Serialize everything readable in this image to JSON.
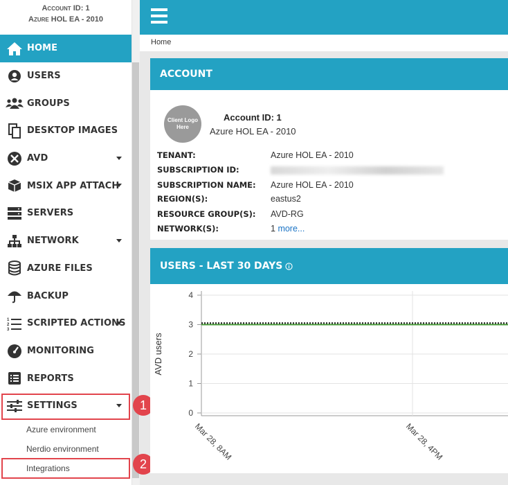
{
  "sidebar": {
    "account_id": "Account ID: 1",
    "account_name": "Azure HOL EA - 2010",
    "items": [
      {
        "label": "HOME",
        "icon": "home-icon",
        "active": true,
        "caret": false
      },
      {
        "label": "USERS",
        "icon": "user-icon",
        "caret": false
      },
      {
        "label": "GROUPS",
        "icon": "group-icon",
        "caret": false
      },
      {
        "label": "DESKTOP IMAGES",
        "icon": "copy-icon",
        "caret": false
      },
      {
        "label": "AVD",
        "icon": "avd-icon",
        "caret": true
      },
      {
        "label": "MSIX APP ATTACH",
        "icon": "box-icon",
        "caret": true
      },
      {
        "label": "SERVERS",
        "icon": "server-icon",
        "caret": false
      },
      {
        "label": "NETWORK",
        "icon": "network-icon",
        "caret": true
      },
      {
        "label": "AZURE FILES",
        "icon": "database-icon",
        "caret": false
      },
      {
        "label": "BACKUP",
        "icon": "umbrella-icon",
        "caret": false
      },
      {
        "label": "SCRIPTED ACTIONS",
        "icon": "list-numbered-icon",
        "caret": true
      },
      {
        "label": "MONITORING",
        "icon": "gauge-icon",
        "caret": false
      },
      {
        "label": "REPORTS",
        "icon": "list-icon",
        "caret": false
      },
      {
        "label": "SETTINGS",
        "icon": "sliders-icon",
        "caret": true
      }
    ],
    "settings_sub": [
      "Azure environment",
      "Nerdio environment",
      "Integrations"
    ]
  },
  "callouts": [
    "1",
    "2"
  ],
  "breadcrumb": "Home",
  "account_card": {
    "title": "ACCOUNT",
    "logo_text": "Client Logo Here",
    "account_id": "Account ID: 1",
    "account_name": "Azure HOL EA - 2010",
    "rows": [
      {
        "key": "TENANT:",
        "value": "Azure HOL EA - 2010"
      },
      {
        "key": "SUBSCRIPTION ID:",
        "value": ""
      },
      {
        "key": "SUBSCRIPTION NAME:",
        "value": "Azure HOL EA - 2010"
      },
      {
        "key": "REGION(S):",
        "value": "eastus2"
      },
      {
        "key": "RESOURCE GROUP(S):",
        "value": "AVD-RG"
      },
      {
        "key": "NETWORK(S):",
        "value": "1 ",
        "link": "more..."
      }
    ]
  },
  "users_card": {
    "title": "USERS - LAST 30 DAYS",
    "info_icon": "info-icon"
  },
  "chart_data": {
    "type": "line",
    "ylabel": "AVD users",
    "xlabel": "",
    "ylim": [
      0,
      4
    ],
    "yticks": [
      "0",
      "1",
      "2",
      "3",
      "4"
    ],
    "xticks": [
      "Mar 28, 8AM",
      "Mar 28, 4PM"
    ],
    "grid": true,
    "series": [
      {
        "name": "",
        "color": "#4a9e3a",
        "style": "solid",
        "values": [
          3,
          3
        ]
      },
      {
        "name": "",
        "color": "#333333",
        "style": "dotted",
        "values": [
          3.05,
          3.05
        ]
      }
    ]
  }
}
